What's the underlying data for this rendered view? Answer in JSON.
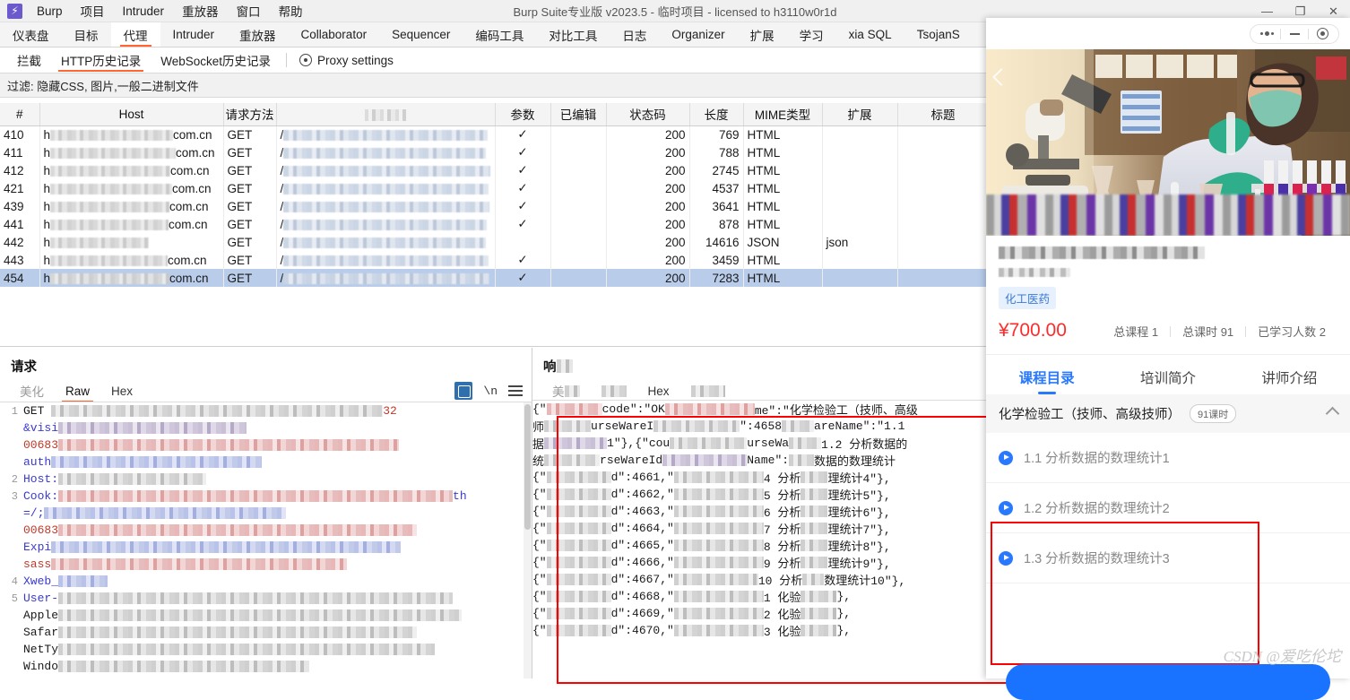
{
  "burp": {
    "window_title": "Burp Suite专业版  v2023.5 - 临时项目 - licensed to h3110w0r1d",
    "logo_glyph": "⚡",
    "menu": [
      "Burp",
      "项目",
      "Intruder",
      "重放器",
      "窗口",
      "帮助"
    ],
    "window_controls": {
      "minimize": "—",
      "maximize": "❐",
      "close": "✕"
    },
    "main_tabs": [
      "仪表盘",
      "目标",
      "代理",
      "Intruder",
      "重放器",
      "Collaborator",
      "Sequencer",
      "编码工具",
      "对比工具",
      "日志",
      "Organizer",
      "扩展",
      "学习",
      "xia SQL",
      "TsojanS"
    ],
    "main_tab_active": "代理",
    "sub_tabs": [
      "拦截",
      "HTTP历史记录",
      "WebSocket历史记录"
    ],
    "sub_tab_active": "HTTP历史记录",
    "proxy_settings_label": "Proxy settings",
    "filter_label": "过滤: 隐藏CSS, 图片,一般二进制文件",
    "table": {
      "columns": [
        "#",
        "Host",
        "请求方法",
        "URL",
        "参数",
        "已编辑",
        "状态码",
        "长度",
        "MIME类型",
        "扩展",
        "标题"
      ],
      "url_column_redacted": true,
      "rows": [
        {
          "id": "410",
          "host_suffix": "com.cn",
          "method": "GET",
          "params": "✓",
          "edited": "",
          "status": "200",
          "length": "769",
          "mime": "HTML",
          "ext": "",
          "title": ""
        },
        {
          "id": "411",
          "host_suffix": "com.cn",
          "method": "GET",
          "params": "✓",
          "edited": "",
          "status": "200",
          "length": "788",
          "mime": "HTML",
          "ext": "",
          "title": ""
        },
        {
          "id": "412",
          "host_suffix": "com.cn",
          "method": "GET",
          "params": "✓",
          "edited": "",
          "status": "200",
          "length": "2745",
          "mime": "HTML",
          "ext": "",
          "title": ""
        },
        {
          "id": "421",
          "host_suffix": "com.cn",
          "method": "GET",
          "params": "✓",
          "edited": "",
          "status": "200",
          "length": "4537",
          "mime": "HTML",
          "ext": "",
          "title": ""
        },
        {
          "id": "439",
          "host_suffix": "com.cn",
          "method": "GET",
          "params": "✓",
          "edited": "",
          "status": "200",
          "length": "3641",
          "mime": "HTML",
          "ext": "",
          "title": ""
        },
        {
          "id": "441",
          "host_suffix": "com.cn",
          "method": "GET",
          "params": "✓",
          "edited": "",
          "status": "200",
          "length": "878",
          "mime": "HTML",
          "ext": "",
          "title": ""
        },
        {
          "id": "442",
          "host_suffix": "",
          "method": "GET",
          "params": "",
          "edited": "",
          "status": "200",
          "length": "14616",
          "mime": "JSON",
          "ext": "json",
          "title": ""
        },
        {
          "id": "443",
          "host_suffix": "com.cn",
          "method": "GET",
          "params": "✓",
          "edited": "",
          "status": "200",
          "length": "3459",
          "mime": "HTML",
          "ext": "",
          "title": ""
        },
        {
          "id": "454",
          "host_suffix": "com.cn",
          "method": "GET",
          "params": "✓",
          "edited": "",
          "status": "200",
          "length": "7283",
          "mime": "HTML",
          "ext": "",
          "title": "",
          "selected": true
        }
      ]
    },
    "request_pane": {
      "title": "请求",
      "tabs": [
        "美化",
        "Raw",
        "Hex"
      ],
      "active_tab": "Raw",
      "tools": {
        "wrap_icon": "word-wrap-icon",
        "newline_label": "\\n",
        "menu_icon": "hamburger-icon"
      },
      "lines": [
        {
          "no": "1",
          "text": "GET"
        },
        {
          "no": "",
          "text": "&visi"
        },
        {
          "no": "",
          "text": "00683"
        },
        {
          "no": "",
          "text": "auth"
        },
        {
          "no": "2",
          "text": "Host:"
        },
        {
          "no": "3",
          "text": "Cook:"
        },
        {
          "no": "",
          "text": "=/; "
        },
        {
          "no": "",
          "text": "00683"
        },
        {
          "no": "",
          "text": "Expi"
        },
        {
          "no": "",
          "text": "sass"
        },
        {
          "no": "4",
          "text": "Xweb_"
        },
        {
          "no": "5",
          "text": "User-"
        },
        {
          "no": "",
          "text": "Apple"
        },
        {
          "no": "",
          "text": "Safar"
        },
        {
          "no": "",
          "text": "NetTy"
        },
        {
          "no": "",
          "text": "Windo"
        }
      ]
    },
    "response_pane": {
      "title": "响应",
      "tabs": [
        "美化",
        "Raw",
        "Hex",
        "渲染"
      ],
      "active_tab": "Raw",
      "lines": [
        {
          "prefix": "{\"",
          "mid": "code\":\"OK",
          "tail": "me\":\"化学检验工（技师、高级"
        },
        {
          "prefix": "师",
          "mid": "urseWareI",
          "tail": "\":4658",
          "tail2": "areName\":\"1.1"
        },
        {
          "prefix": "据",
          "mid": "1\"},{\"cou",
          "tail": "urseWa",
          "tail2": "1.2 分析数据的"
        },
        {
          "prefix": "统",
          "mid": "rseWareId",
          "tail": "Name\":",
          "tail2": "数据的数理统计"
        },
        {
          "prefix": "{\"",
          "mid": "d\":4661,\"",
          "tail": "4 分析",
          "tail2": "理统计4\"},"
        },
        {
          "prefix": "{\"",
          "mid": "d\":4662,\"",
          "tail": "5 分析",
          "tail2": "理统计5\"},"
        },
        {
          "prefix": "{\"",
          "mid": "d\":4663,\"",
          "tail": "6 分析",
          "tail2": "理统计6\"},"
        },
        {
          "prefix": "{\"",
          "mid": "d\":4664,\"",
          "tail": "7 分析",
          "tail2": "理统计7\"},"
        },
        {
          "prefix": "{\"",
          "mid": "d\":4665,\"",
          "tail": "8 分析",
          "tail2": "理统计8\"},"
        },
        {
          "prefix": "{\"",
          "mid": "d\":4666,\"",
          "tail": "9 分析",
          "tail2": "理统计9\"},"
        },
        {
          "prefix": "{\"",
          "mid": "d\":4667,\"",
          "tail": "10 分析",
          "tail2": "数理统计10\"},"
        },
        {
          "prefix": "{\"",
          "mid": "d\":4668,\"",
          "tail": "1 化验",
          "tail2": "},"
        },
        {
          "prefix": "{\"",
          "mid": "d\":4669,\"",
          "tail": "2 化验",
          "tail2": "},"
        },
        {
          "prefix": "{\"",
          "mid": "d\":4670,\"",
          "tail": "3 化验",
          "tail2": "},"
        }
      ]
    }
  },
  "mini": {
    "caption": {
      "more_icon": "more-dots-icon",
      "minimize_icon": "minimize-icon",
      "close_icon": "close-target-icon"
    },
    "hero": {
      "alt": "lab-scientist-photo",
      "back_icon": "back-chevron-icon"
    },
    "course": {
      "title_redacted": true,
      "subtitle_redacted": true,
      "tag": "化工医药",
      "price": "¥700.00",
      "stats": [
        "总课程 1",
        "总课时 91",
        "已学习人数 2"
      ]
    },
    "tabs": [
      "课程目录",
      "培训简介",
      "讲师介绍"
    ],
    "tab_active": "课程目录",
    "chapter": {
      "name": "化学检验工（技师、高级技师）",
      "chip": "91课时",
      "collapse_icon": "chevron-up-icon"
    },
    "lessons": [
      "1.1 分析数据的数理统计1",
      "1.2 分析数据的数理统计2",
      "1.3 分析数据的数理统计3"
    ],
    "watermark": "CSDN @爱吃伦坨",
    "cta_label": ""
  },
  "colors": {
    "accent_orange": "#ff6633",
    "accent_blue": "#2979ff",
    "price_red": "#ff2b2b",
    "highlight_red": "#ff0000",
    "row_selected": "#b9cdeb"
  }
}
